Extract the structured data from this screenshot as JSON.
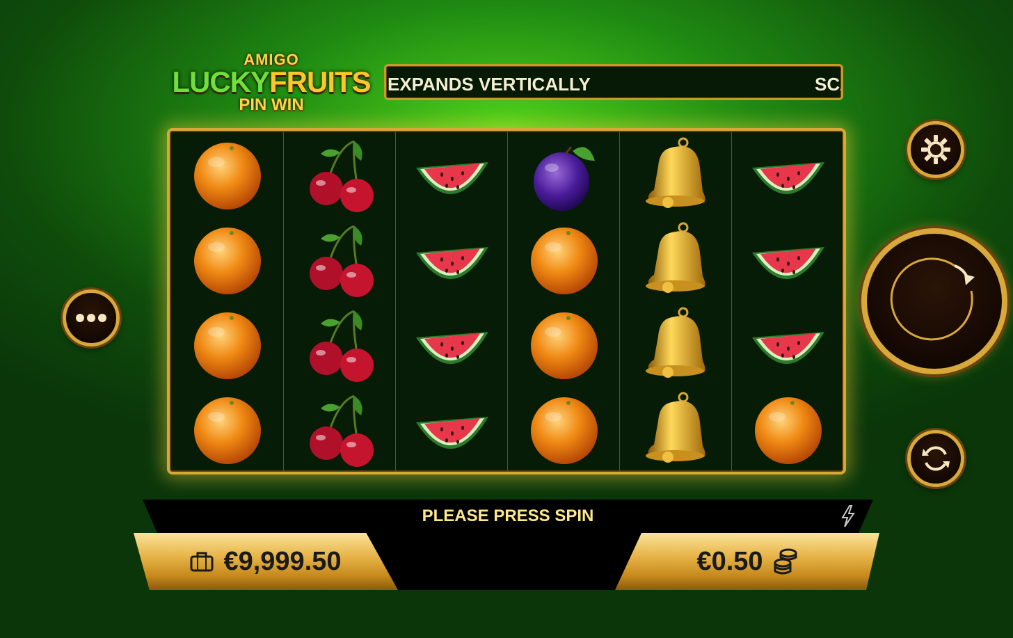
{
  "logo": {
    "line1": "AMIGO",
    "line2a": "LUCKY",
    "line2b": "FRUITS",
    "line3": "PIN WIN"
  },
  "ticker": {
    "text_main": "EXPANDS VERTICALLY",
    "text_next": "SCA"
  },
  "reels": [
    [
      "orange",
      "orange",
      "orange",
      "orange"
    ],
    [
      "cherry",
      "cherry",
      "cherry",
      "cherry"
    ],
    [
      "watermelon",
      "watermelon",
      "watermelon",
      "watermelon"
    ],
    [
      "plum",
      "orange",
      "orange",
      "orange"
    ],
    [
      "bell",
      "bell",
      "bell",
      "bell"
    ],
    [
      "watermelon",
      "watermelon",
      "watermelon",
      "orange"
    ]
  ],
  "status": {
    "message": "PLEASE PRESS SPIN"
  },
  "balance": {
    "value": "€9,999.50",
    "icon": "wallet-icon"
  },
  "bet": {
    "value": "€0.50",
    "icon": "coins-icon"
  },
  "controls": {
    "menu_icon": "more-icon",
    "settings_icon": "gear-icon",
    "spin_icon": "spin-arrow-icon",
    "autoplay_icon": "autoplay-icon",
    "turbo_icon": "lightning-icon"
  },
  "colors": {
    "gold": "#d8a83a",
    "background_green": "#1f8a12",
    "status_text": "#ffe88a"
  }
}
